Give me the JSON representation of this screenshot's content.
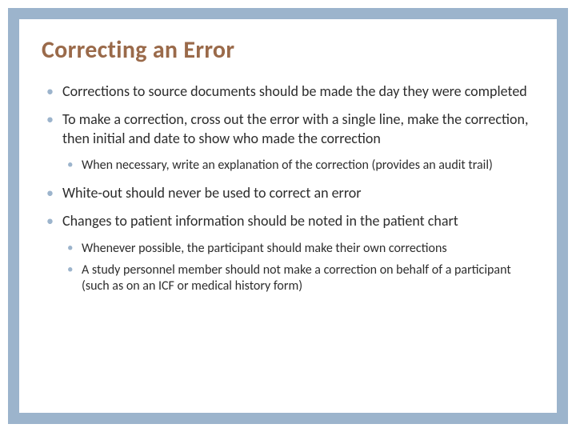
{
  "title": "Correcting an Error",
  "bullets": {
    "b1": "Corrections to source documents should be made the day they were completed",
    "b2": "To make a correction, cross out the error with a single line, make the correction, then initial and date to show who made the correction",
    "b2_sub1": "When necessary, write an explanation of the correction (provides an audit trail)",
    "b3": "White-out should never be used to correct an error",
    "b4": "Changes to patient information should be noted in the patient chart",
    "b4_sub1": "Whenever possible, the participant should make their own corrections",
    "b4_sub2": "A study personnel member should not make a correction on behalf of a participant (such as on an ICF or medical history form)"
  }
}
